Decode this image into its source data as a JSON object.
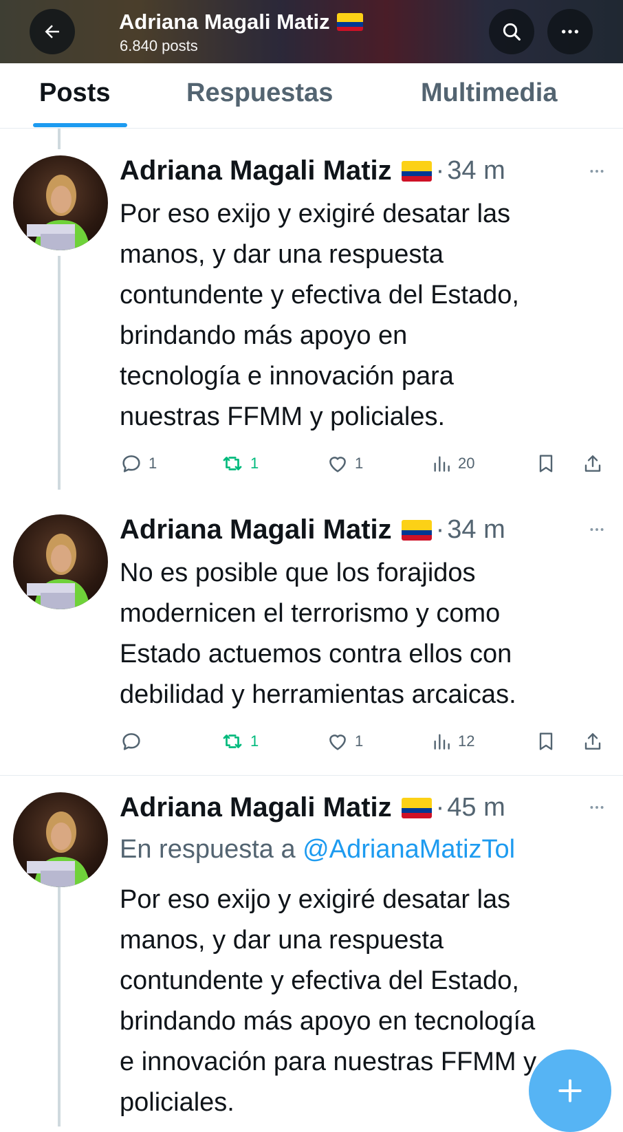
{
  "header": {
    "name": "Adriana Magali Matiz",
    "flag": "colombia-flag",
    "posts_count": "6.840 posts",
    "icons": [
      "back-arrow-icon",
      "search-icon",
      "more-icon"
    ]
  },
  "tabs": [
    {
      "label": "Posts",
      "active": true
    },
    {
      "label": "Respuestas",
      "active": false
    },
    {
      "label": "Multimedia",
      "active": false
    }
  ],
  "tweets": [
    {
      "author": "Adriana Magali Matiz",
      "time": "34 m",
      "reply_to_prefix": "",
      "reply_to_handle": "",
      "text": "Por eso exijo y exigiré desatar las\nmanos, y dar una respuesta\ncontundente y efectiva del Estado,\nbrindando más apoyo en\ntecnología e innovación para\nnuestras FFMM y policiales.",
      "replies": "1",
      "reposts": "1",
      "likes": "1",
      "views": "20"
    },
    {
      "author": "Adriana Magali Matiz",
      "time": "34 m",
      "reply_to_prefix": "",
      "reply_to_handle": "",
      "text": "No es posible que los forajidos\nmodernicen el terrorismo y como\nEstado actuemos contra ellos con\ndebilidad y herramientas arcaicas.",
      "replies": "",
      "reposts": "1",
      "likes": "1",
      "views": "12"
    },
    {
      "author": "Adriana Magali Matiz",
      "time": "45 m",
      "reply_to_prefix": "En respuesta a ",
      "reply_to_handle": "@AdrianaMatizTol",
      "text": "Por eso exijo y exigiré desatar las\nmanos, y dar una respuesta\ncontundente y efectiva del Estado,\nbrindando más apoyo en tecnología\ne innovación para nuestras FFMM y\npoliciales."
    }
  ],
  "colors": {
    "accent": "#1d9bf0",
    "repost_green": "#00ba7c",
    "muted_text": "#536471",
    "text": "#0f1419"
  }
}
